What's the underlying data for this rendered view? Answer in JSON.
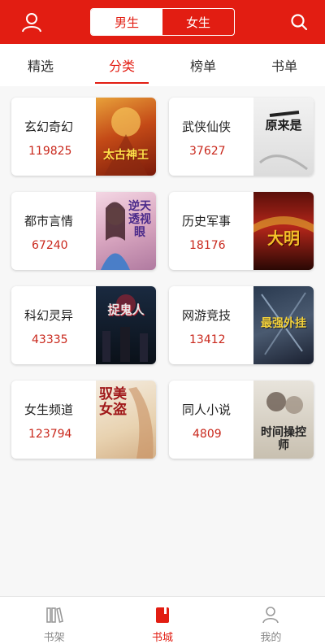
{
  "header": {
    "user_icon": "user-icon",
    "search_icon": "search-icon",
    "gender_tabs": [
      {
        "label": "男生",
        "active": true
      },
      {
        "label": "女生",
        "active": false
      }
    ],
    "accent_color": "#e21d12"
  },
  "tabs": [
    {
      "label": "精选",
      "active": false
    },
    {
      "label": "分类",
      "active": true
    },
    {
      "label": "榜单",
      "active": false
    },
    {
      "label": "书单",
      "active": false
    }
  ],
  "categories": [
    {
      "name": "玄幻奇幻",
      "count": "119825",
      "cover_text": "太古神王"
    },
    {
      "name": "武侠仙侠",
      "count": "37627",
      "cover_text": "原来是"
    },
    {
      "name": "都市言情",
      "count": "67240",
      "cover_text": "逆天透视眼"
    },
    {
      "name": "历史军事",
      "count": "18176",
      "cover_text": "大明"
    },
    {
      "name": "科幻灵异",
      "count": "43335",
      "cover_text": "捉鬼人"
    },
    {
      "name": "网游竞技",
      "count": "13412",
      "cover_text": "最强外挂"
    },
    {
      "name": "女生频道",
      "count": "123794",
      "cover_text": "驭美女盗"
    },
    {
      "name": "同人小说",
      "count": "4809",
      "cover_text": "时间操控师"
    }
  ],
  "bottom_nav": [
    {
      "label": "书架",
      "icon": "bookshelf-icon",
      "active": false
    },
    {
      "label": "书城",
      "icon": "bookstore-icon",
      "active": true
    },
    {
      "label": "我的",
      "icon": "profile-icon",
      "active": false
    }
  ]
}
